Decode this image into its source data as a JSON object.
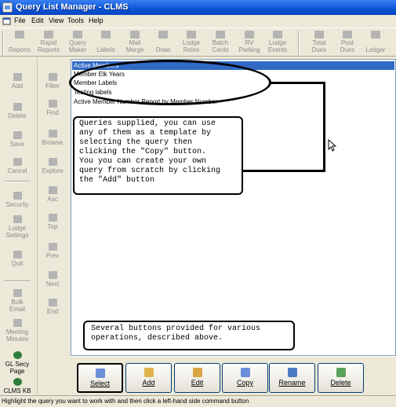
{
  "window": {
    "title": "Query List Manager - CLMS"
  },
  "menu": [
    "File",
    "Edit",
    "View",
    "Tools",
    "Help"
  ],
  "toolbar": [
    "Reports",
    "Rapid\nReports",
    "Query\nMaker",
    "Labels",
    "Mail\nMerge",
    "Draw",
    "Lodge\nRoles",
    "Batch\nCards",
    "RV\nParking",
    "Lodge\nEvents",
    "Total\nDues",
    "Post\nDues",
    "Ledger"
  ],
  "sidebar_left": [
    "Add",
    "Delete",
    "Save",
    "Cancel",
    "Security",
    "Lodge\nSettings",
    "Quit",
    "Bulk\nEmail",
    "Meeting\nMinutes",
    "GL Secy\nPage",
    "CLMS KB"
  ],
  "sidebar_nav": [
    "Filter",
    "Find",
    "Browse",
    "Explore",
    "Asc",
    "Top",
    "Prev",
    "Next",
    "End"
  ],
  "queries": [
    "Active Members",
    "Member Elk Years",
    "Member Labels",
    "Testing labels",
    "Active Member Number Report by Member Number"
  ],
  "callouts": {
    "queries": "Queries supplied, you can use\nany of them as a template by\nselecting the query then\nclicking the \"Copy\" button.\nYou you can create your own\nquery from scratch by clicking\nthe \"Add\" button",
    "buttons": "Several buttons provided for various\noperations, described above."
  },
  "buttons": [
    {
      "label": "Select",
      "icon": "select-icon",
      "color": "#6a8fd8"
    },
    {
      "label": "Add",
      "icon": "add-icon",
      "color": "#e0b44c"
    },
    {
      "label": "Edit",
      "icon": "edit-icon",
      "color": "#d9a441"
    },
    {
      "label": "Copy",
      "icon": "copy-icon",
      "color": "#6a8fd8"
    },
    {
      "label": "Rename",
      "icon": "rename-icon",
      "color": "#4d7cc4"
    },
    {
      "label": "Delete",
      "icon": "delete-icon",
      "color": "#5aa35a"
    }
  ],
  "statusbar": "Highlight the query you want to work with and then click a left-hand side command button"
}
